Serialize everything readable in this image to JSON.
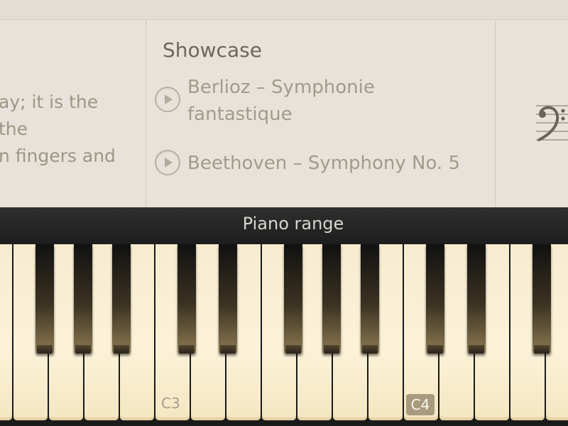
{
  "description": {
    "line1": "ay; it is the",
    "line2": " the",
    "line3": "n fingers and"
  },
  "showcase": {
    "title": "Showcase",
    "items": [
      {
        "label": "Berlioz – Symphonie fantastique"
      },
      {
        "label": "Beethoven – Symphony No. 5"
      }
    ]
  },
  "bar": {
    "title": "Piano range"
  },
  "keyboard": {
    "labels": {
      "c3": "C3",
      "c4": "C4"
    },
    "highlighted_key": "C4",
    "icons": {
      "play": "play-icon",
      "clef": "bass-clef-icon"
    }
  },
  "colors": {
    "background": "#e7e2d9",
    "bar": "#242424",
    "key_highlight": "#a89a7e"
  }
}
